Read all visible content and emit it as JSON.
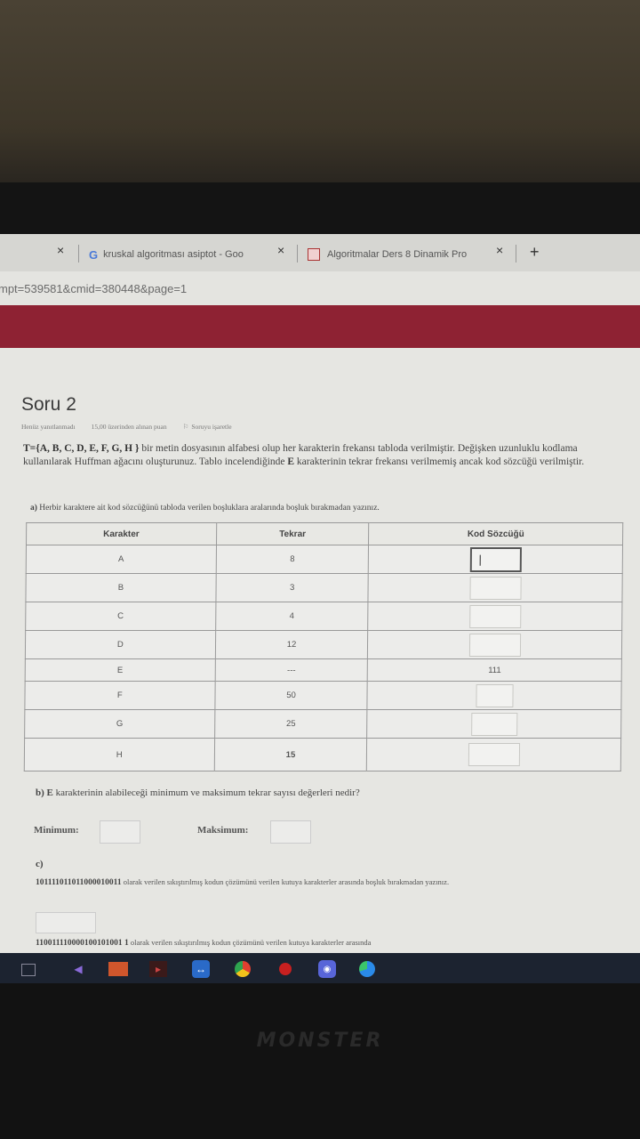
{
  "browser": {
    "tabs": [
      {
        "label": "kruskal algoritması asiptot - Goo"
      },
      {
        "label": "Algoritmalar Ders 8 Dinamik Pro"
      }
    ],
    "close_glyph": "×",
    "new_tab_glyph": "+",
    "google_glyph": "G",
    "url": "mpt=539581&cmid=380448&page=1"
  },
  "question": {
    "title": "Soru 2",
    "status": "Henüz yanıtlanmadı",
    "points": "15,00 üzerinden alınan puan",
    "flag_label": "Soruyu işaretle",
    "flag_icon": "flag-icon",
    "intro_bold": "T={A, B, C, D, E, F, G, H }",
    "intro_text1": " bir metin dosyasının alfabesi olup her karakterin frekansı tabloda verilmiştir. Değişken uzunluklu kodlama kullanılarak Huffman ağacını oluşturunuz. Tablo incelendiğinde ",
    "intro_bold2": "E",
    "intro_text2": " karakterinin tekrar frekansı verilmemiş ancak kod sözcüğü verilmiştir.",
    "part_a_label": "a)",
    "part_a": "Herbir karaktere ait kod sözcüğünü tabloda verilen boşluklara aralarında boşluk bırakmadan yazınız.",
    "table": {
      "headers": [
        "Karakter",
        "Tekrar",
        "Kod Sözcüğü"
      ],
      "rows": [
        {
          "char": "A",
          "freq": "8",
          "code": ""
        },
        {
          "char": "B",
          "freq": "3",
          "code": ""
        },
        {
          "char": "C",
          "freq": "4",
          "code": ""
        },
        {
          "char": "D",
          "freq": "12",
          "code": ""
        },
        {
          "char": "E",
          "freq": "---",
          "code": "111"
        },
        {
          "char": "F",
          "freq": "50",
          "code": ""
        },
        {
          "char": "G",
          "freq": "25",
          "code": ""
        },
        {
          "char": "H",
          "freq": "15",
          "code": ""
        }
      ]
    },
    "part_b_label": "b)",
    "part_b_bold": "E",
    "part_b": " karakterinin alabileceği minimum ve maksimum tekrar sayısı değerleri nedir?",
    "min_label": "Minimum:",
    "max_label": "Maksimum:",
    "part_c_label": "c)",
    "c1_bits": "101111011011000010011",
    "c1_text": " olarak verilen sıkıştırılmış kodun çözümünü verilen kutuya karakterler arasında boşluk bırakmadan yazınız.",
    "c2_bits": "110011110000100101001 1",
    "c2_text": " olarak verilen sıkıştırılmış kodun çözümünü verilen kutuya karakterler arasında"
  },
  "taskbar": {
    "icons": [
      "task-view-icon",
      "visual-studio-icon",
      "app-icon",
      "terminal-icon",
      "teamviewer-icon",
      "chrome-icon",
      "record-icon",
      "discord-icon",
      "edge-icon"
    ]
  },
  "laptop": {
    "brand": "MONSTER"
  }
}
